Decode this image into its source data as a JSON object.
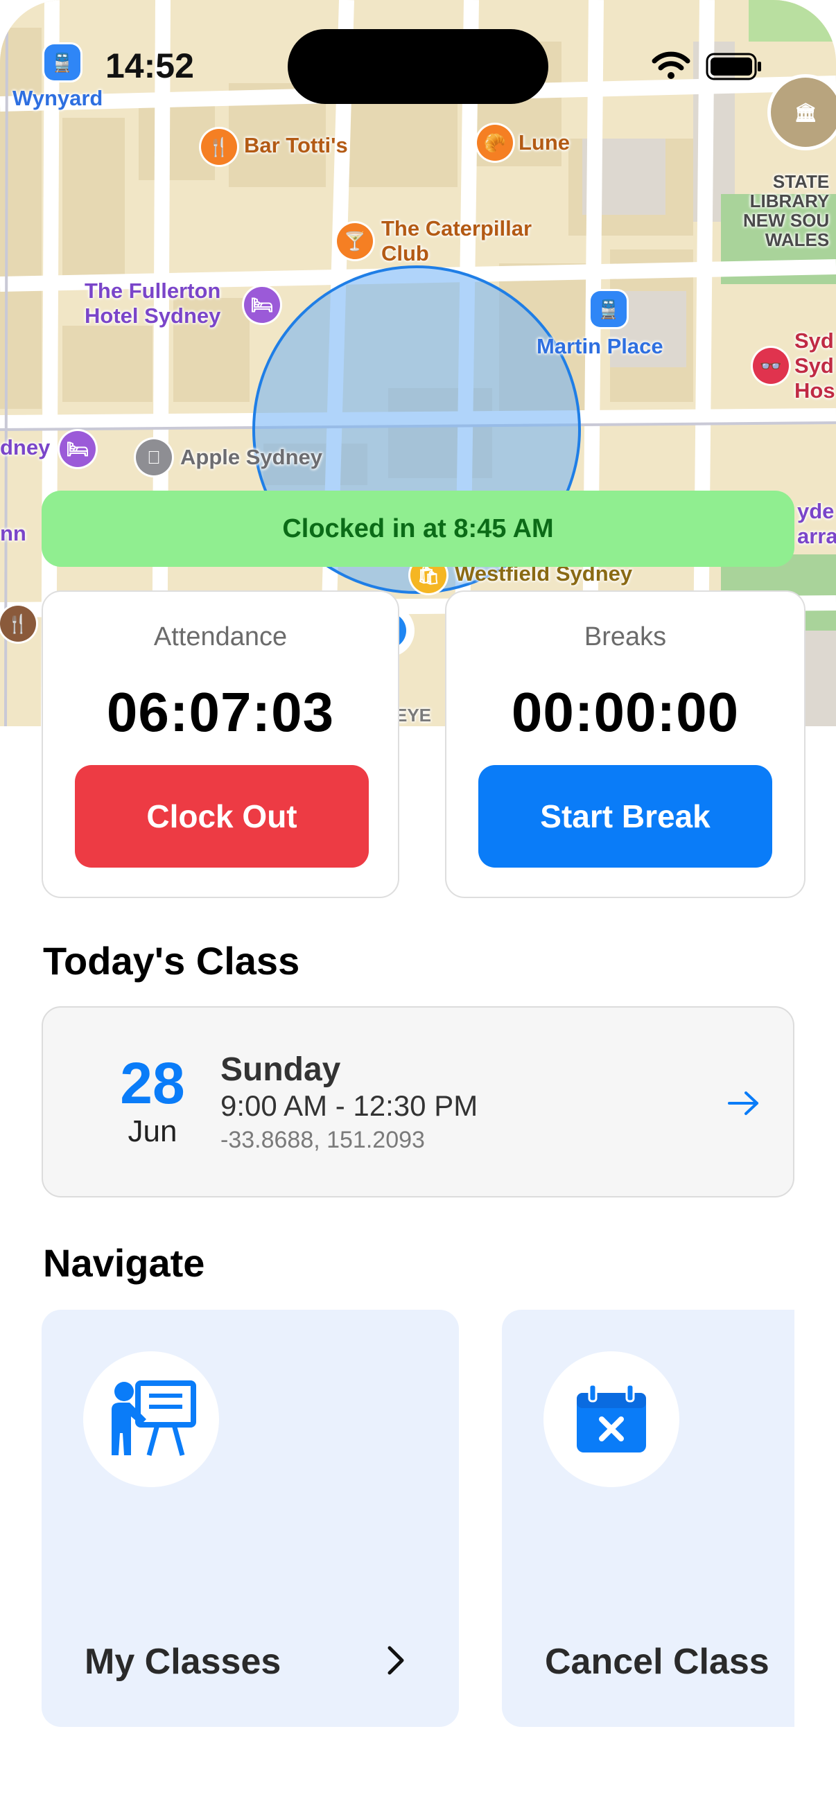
{
  "status_bar": {
    "time": "14:52"
  },
  "map": {
    "labels": {
      "wynyard": "Wynyard",
      "bar_tottis": "Bar Totti's",
      "lune": "Lune",
      "caterpillar_1": "The Caterpillar",
      "caterpillar_2": "Club",
      "fullerton_1": "The Fullerton",
      "fullerton_2": "Hotel Sydney",
      "martin_place": "Martin Place",
      "apple_sydney": "Apple Sydney",
      "westfield": "Westfield Sydney",
      "dney": "dney",
      "library_1": "STATE",
      "library_2": "LIBRARY",
      "library_3": "NEW SOU",
      "library_4": "WALES",
      "syd_1": "Syd",
      "syd_2": "Syd",
      "syd_3": "Hos",
      "yde": "yde",
      "arra": "arra",
      "nn": "nn",
      "eye": "EYE"
    },
    "colors": {
      "land": "#f1e6c6",
      "road": "#ffffff",
      "geofence": "#6fb1f5"
    }
  },
  "clock_banner": {
    "text": "Clocked in at 8:45 AM"
  },
  "attendance": {
    "label": "Attendance",
    "timer": "06:07:03",
    "button": "Clock Out",
    "color": "#ed3b44"
  },
  "breaks": {
    "label": "Breaks",
    "timer": "00:00:00",
    "button": "Start Break",
    "color": "#0a7cf8"
  },
  "todays_class": {
    "heading": "Today's Class",
    "day_num": "28",
    "month": "Jun",
    "weekday": "Sunday",
    "time": "9:00 AM - 12:30 PM",
    "coords": "-33.8688, 151.2093"
  },
  "navigate": {
    "heading": "Navigate",
    "cards": [
      {
        "label": "My Classes",
        "icon": "teacher-board-icon"
      },
      {
        "label": "Cancel Class",
        "icon": "calendar-cancel-icon"
      }
    ]
  }
}
